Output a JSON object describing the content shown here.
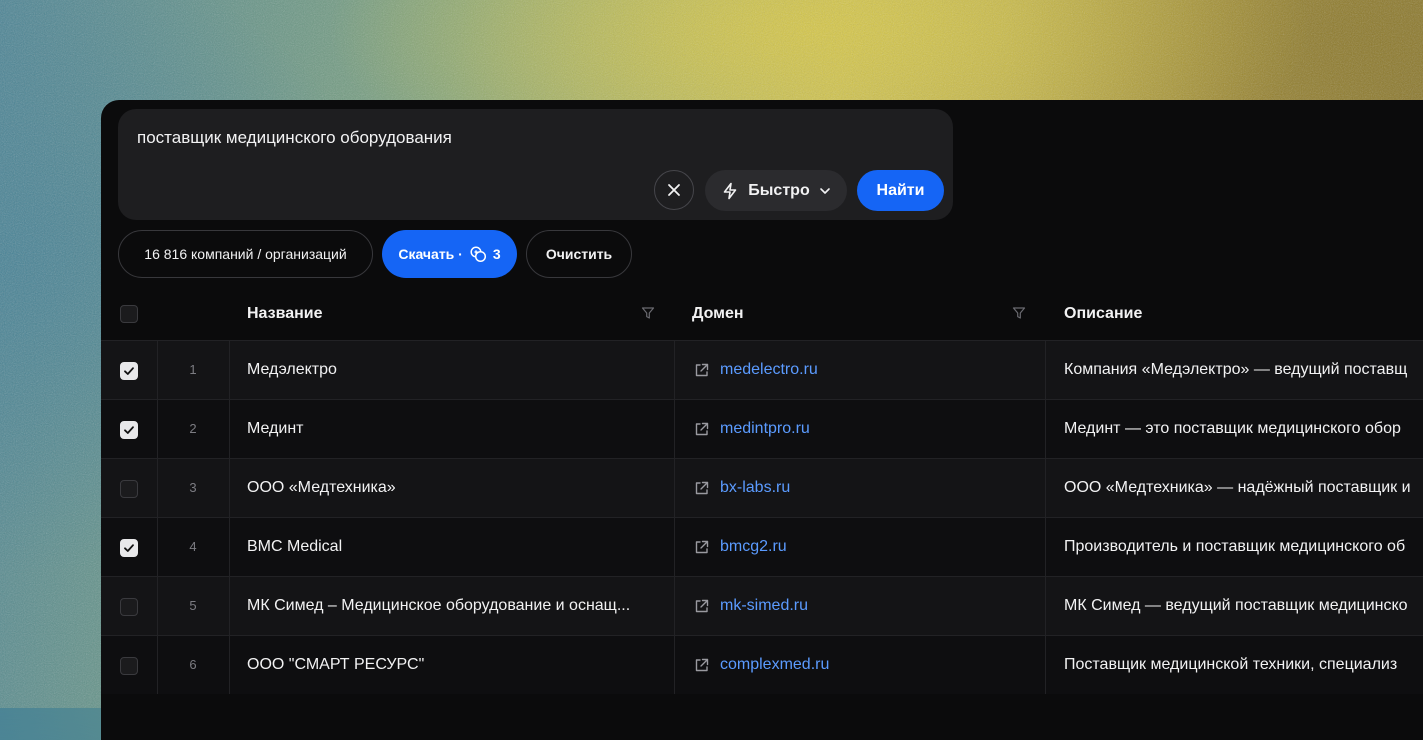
{
  "search": {
    "query": "поставщик медицинского оборудования",
    "mode_label": "Быстро",
    "find_label": "Найти"
  },
  "toolbar": {
    "count_label": "16 816 компаний / организаций",
    "download_label": "Скачать ·",
    "download_count": "3",
    "clear_label": "Очистить"
  },
  "table": {
    "columns": {
      "name": "Название",
      "domain": "Домен",
      "description": "Описание"
    },
    "rows": [
      {
        "index": "1",
        "checked": true,
        "name": "Медэлектро",
        "domain": "medelectro.ru",
        "description": "Компания «Медэлектро» — ведущий поставщ"
      },
      {
        "index": "2",
        "checked": true,
        "name": "Мединт",
        "domain": "medintpro.ru",
        "description": "Мединт — это поставщик медицинского обор"
      },
      {
        "index": "3",
        "checked": false,
        "name": "ООО «Медтехника»",
        "domain": "bx-labs.ru",
        "description": "ООО «Медтехника» — надёжный поставщик и"
      },
      {
        "index": "4",
        "checked": true,
        "name": "BMC Medical",
        "domain": "bmcg2.ru",
        "description": "Производитель и поставщик медицинского об"
      },
      {
        "index": "5",
        "checked": false,
        "name": "МК Симед – Медицинское оборудование и оснащ...",
        "domain": "mk-simed.ru",
        "description": "МК Симед — ведущий поставщик медицинско"
      },
      {
        "index": "6",
        "checked": false,
        "name": "ООО \"СМАРТ РЕСУРС\"",
        "domain": "complexmed.ru",
        "description": "Поставщик медицинской техники, специализ"
      }
    ]
  },
  "colors": {
    "accent": "#1565f5",
    "link": "#5b9bff",
    "panel": "#0b0b0c"
  }
}
